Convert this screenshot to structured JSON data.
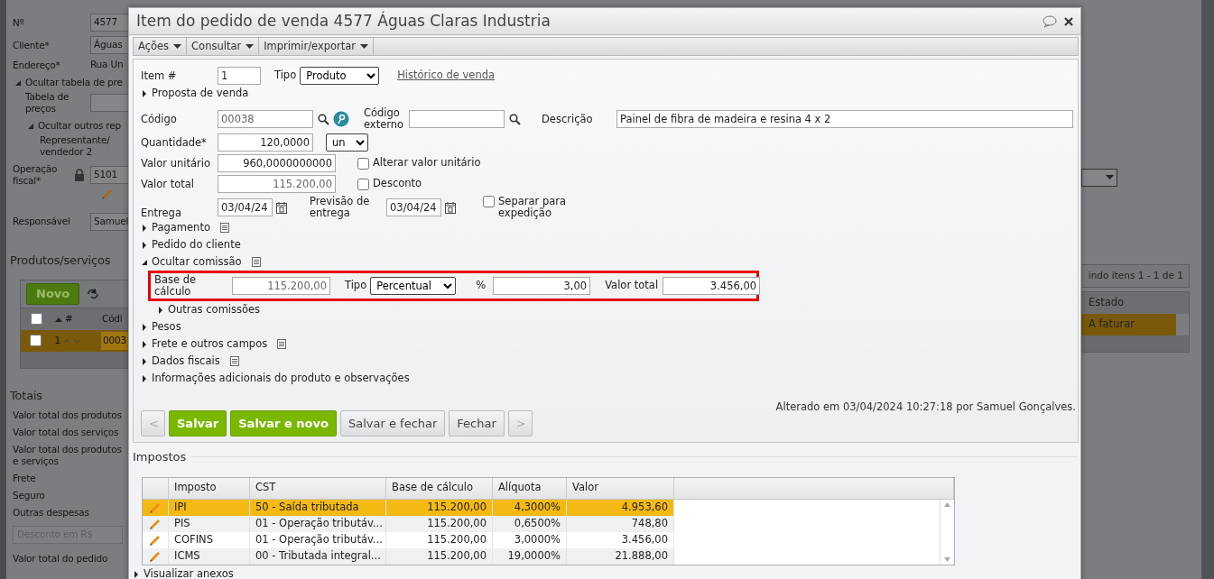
{
  "background": {
    "number": {
      "label": "Nº",
      "value": "4577"
    },
    "client": {
      "label": "Cliente*",
      "value": "Águas"
    },
    "address": {
      "label": "Endereço*",
      "value": "Rua Un"
    },
    "price_table_toggle": {
      "label": "Ocultar tabela de pre",
      "expanded": true
    },
    "price_table": {
      "label": "Tabela de preços"
    },
    "other_reps_toggle": {
      "label": "Ocultar outros rep",
      "expanded": true
    },
    "rep2": {
      "label": "Representante/ vendedor 2"
    },
    "fiscal_op": {
      "label": "Operação fiscal*",
      "value": "5101"
    },
    "responsible": {
      "label": "Responsável",
      "value": "Samuel"
    },
    "products_title": "Produtos/serviços",
    "new_button": "Novo",
    "grid": {
      "all_checked": false,
      "columns": [
        "#",
        "Códi"
      ],
      "rows": [
        {
          "number": "1",
          "code": "0003",
          "selected": true,
          "checked": false
        }
      ]
    },
    "pager": "indo itens 1 - 1 de 1",
    "grid_right": {
      "column": "Estado",
      "rows": [
        {
          "cell": "A faturar",
          "selected": true
        }
      ]
    },
    "totals_title": "Totais",
    "totals": [
      "Valor total dos produtos",
      "Valor total dos serviços",
      "Valor total dos produtos e serviços",
      "Frete",
      "Seguro",
      "Outras despesas"
    ],
    "discount_select": "Desconto em R$",
    "order_total": "Valor total do pedido"
  },
  "dialog": {
    "title": "Item do pedido de venda 4577 Águas Claras Industria",
    "menus": [
      {
        "label": "Ações"
      },
      {
        "label": "Consultar"
      },
      {
        "label": "Imprimir/exportar"
      }
    ],
    "item": {
      "label": "Item #",
      "value": "1"
    },
    "type": {
      "label": "Tipo",
      "value": "Produto"
    },
    "history_link": "Histórico de venda",
    "proposal": {
      "label": "Proposta de venda",
      "expanded": false
    },
    "code": {
      "label": "Código",
      "value": "00038",
      "readonly": true
    },
    "external_code": {
      "label": "Código externo"
    },
    "description": {
      "label": "Descrição",
      "value": "Painel de fibra de madeira e resina 4 x 2"
    },
    "quantity": {
      "label": "Quantidade*",
      "value": "120,0000",
      "unit": "un"
    },
    "unit_price": {
      "label": "Valor unitário",
      "value": "960,0000000000",
      "checkbox": {
        "label": "Alterar valor unitário",
        "checked": false
      }
    },
    "total": {
      "label": "Valor total",
      "value": "115.200,00",
      "readonly": true,
      "checkbox": {
        "label": "Desconto",
        "checked": false
      }
    },
    "delivery": {
      "label": "Entrega",
      "value": "03/04/24"
    },
    "forecast": {
      "label": "Previsão de entrega",
      "value": "03/04/24"
    },
    "separate": {
      "label": "Separar para expedição",
      "checked": false
    },
    "sections_before": [
      {
        "label": "Pagamento",
        "expanded": false,
        "note": true
      },
      {
        "label": "Pedido do cliente",
        "expanded": false,
        "note": false
      },
      {
        "label": "Ocultar comissão",
        "expanded": true,
        "note": true
      }
    ],
    "commission": {
      "highlighted": true,
      "base_label": "Base de cálculo",
      "base_value": "115.200,00",
      "type_label": "Tipo",
      "type_value": "Percentual",
      "percent_label": "%",
      "percent_value": "3,00",
      "total_label": "Valor total",
      "total_value": "3.456,00"
    },
    "other_commissions": {
      "label": "Outras comissões",
      "expanded": false
    },
    "sections_after": [
      {
        "label": "Pesos",
        "expanded": false,
        "note": false
      },
      {
        "label": "Frete e outros campos",
        "expanded": false,
        "note": true
      },
      {
        "label": "Dados fiscais",
        "expanded": false,
        "note": true
      },
      {
        "label": "Informações adicionais do produto e observações",
        "expanded": false,
        "note": false
      }
    ],
    "buttons": [
      {
        "label": "<",
        "kind": "nav",
        "disabled": true
      },
      {
        "label": "Salvar",
        "kind": "primary",
        "disabled": false
      },
      {
        "label": "Salvar e novo",
        "kind": "primary",
        "disabled": false
      },
      {
        "label": "Salvar e fechar",
        "kind": "default",
        "disabled": false
      },
      {
        "label": "Fechar",
        "kind": "default",
        "disabled": false
      },
      {
        "label": ">",
        "kind": "nav",
        "disabled": true
      }
    ],
    "modified": "Alterado em 03/04/2024 10:27:18 por Samuel Gonçalves.",
    "taxes": {
      "title": "Impostos",
      "columns": [
        "Imposto",
        "CST",
        "Base de cálculo",
        "Alíquota",
        "Valor"
      ],
      "rows": [
        {
          "cells": [
            "IPI",
            "50 - Saída tributada",
            "115.200,00",
            "4,3000%",
            "4.953,60"
          ],
          "selected": true
        },
        {
          "cells": [
            "PIS",
            "01 - Operação tributáv...",
            "115.200,00",
            "0,6500%",
            "748,80"
          ],
          "selected": false
        },
        {
          "cells": [
            "COFINS",
            "01 - Operação tributáv...",
            "115.200,00",
            "3,0000%",
            "3.456,00"
          ],
          "selected": false
        },
        {
          "cells": [
            "ICMS",
            "00 - Tributada integral...",
            "115.200,00",
            "19,0000%",
            "21.888,00"
          ],
          "selected": false
        }
      ]
    },
    "attachments": {
      "label": "Visualizar anexos",
      "expanded": false
    }
  }
}
